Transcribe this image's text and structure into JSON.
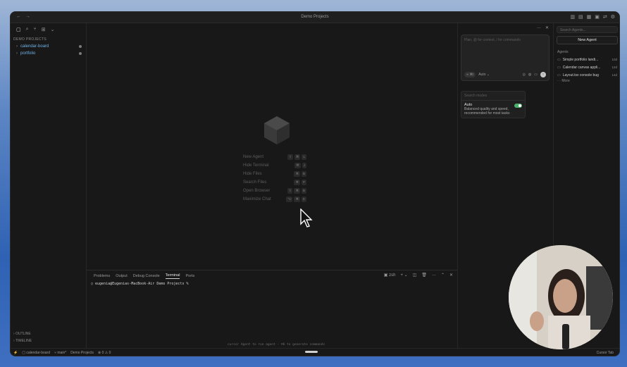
{
  "window": {
    "title": "Demo Projects"
  },
  "titlebar": {
    "back_icon": "arrow-left-icon",
    "forward_icon": "arrow-right-icon"
  },
  "sidebar": {
    "section": "DEMO PROJECTS",
    "items": [
      {
        "label": "calendar-board"
      },
      {
        "label": "portfolio"
      }
    ],
    "bottom": [
      "OUTLINE",
      "TIMELINE"
    ]
  },
  "editor": {
    "shortcuts": [
      {
        "label": "New Agent",
        "keys": [
          "⇧",
          "⌘",
          "L"
        ]
      },
      {
        "label": "Hide Terminal",
        "keys": [
          "⌘",
          "J"
        ]
      },
      {
        "label": "Hide Files",
        "keys": [
          "⌘",
          "B"
        ]
      },
      {
        "label": "Search Files",
        "keys": [
          "⌘",
          "P"
        ]
      },
      {
        "label": "Open Browser",
        "keys": [
          "⇧",
          "⌘",
          "B"
        ]
      },
      {
        "label": "Maximize Chat",
        "keys": [
          "⌥",
          "⌘",
          "E"
        ]
      }
    ]
  },
  "panel": {
    "tabs": [
      "Problems",
      "Output",
      "Debug Console",
      "Terminal",
      "Ports"
    ],
    "active_tab": "Terminal",
    "shell": "zsh",
    "prompt": "eugenia@Eugenias-MacBook-Air Demo Projects %",
    "hint": "cursor  Agent to run agent · ⌘K to generate commands"
  },
  "chat": {
    "placeholder": "Plan, @ for context, / for commands",
    "mode_pill": "∞ ⌘I",
    "model": "Auto",
    "search_placeholder": "Search modes",
    "option": {
      "name": "Auto",
      "desc": "Balanced quality and speed, recommended for most tasks"
    }
  },
  "agents": {
    "search_placeholder": "Search Agents...",
    "new_label": "New Agent",
    "section": "Agents",
    "items": [
      {
        "label": "Simple portfolio landi...",
        "time": "10d"
      },
      {
        "label": "Calendar canvas appli...",
        "time": "12d"
      },
      {
        "label": "Layout.tsx console bug",
        "time": "14d"
      }
    ],
    "more": "More"
  },
  "statusbar": {
    "branch_repo": "calendar-board",
    "branch": "main*",
    "workspace": "Demo Projects",
    "problems": "⊗ 0 ⚠ 0",
    "right": "Cursor Tab"
  },
  "colors": {
    "accent_link": "#6fb3e8",
    "toggle_on": "#4caf6a"
  }
}
